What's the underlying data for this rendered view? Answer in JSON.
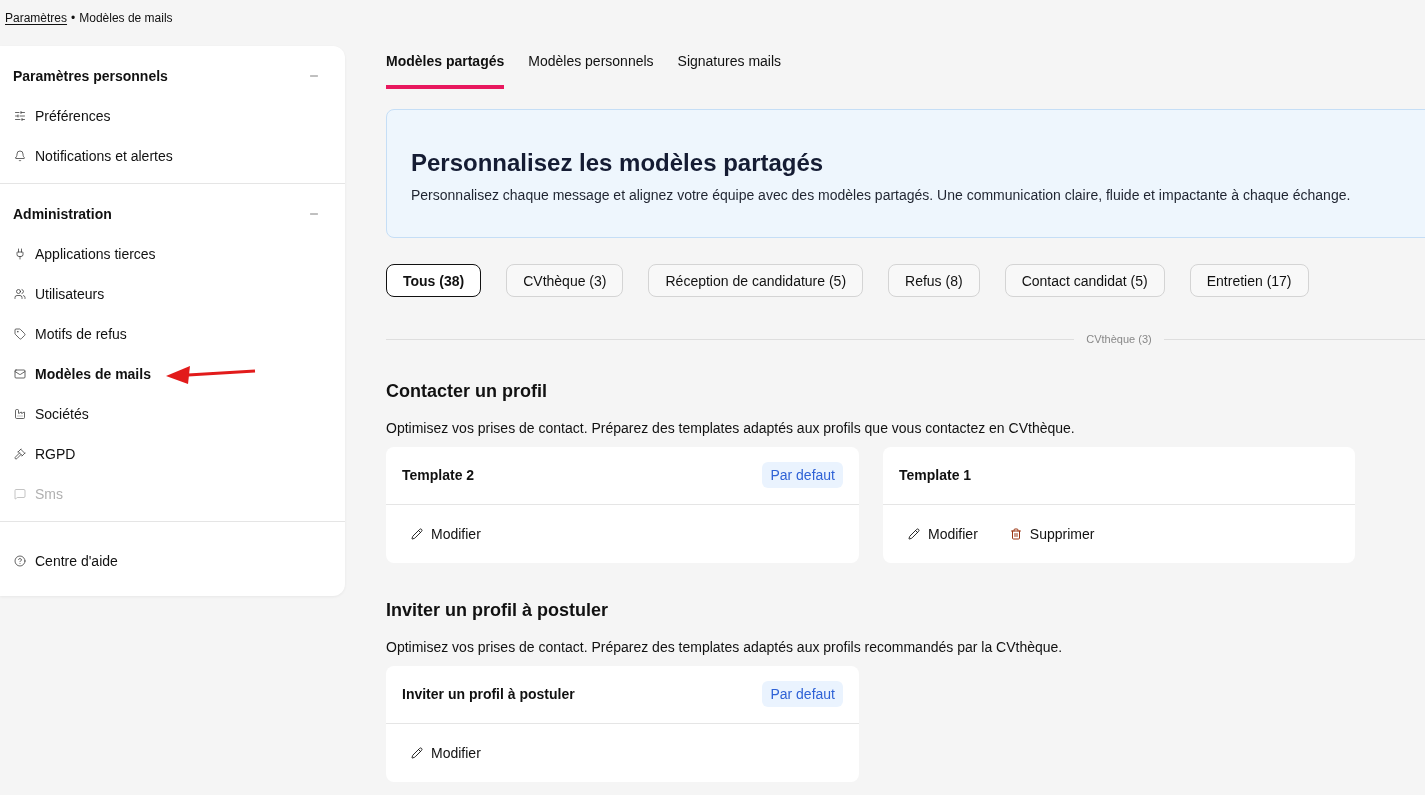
{
  "breadcrumb": {
    "items": [
      {
        "label": "Paramètres",
        "kind": "link"
      },
      {
        "label": "Modèles de mails",
        "kind": "current"
      }
    ],
    "separator": "•"
  },
  "sidebar": {
    "sections": [
      {
        "title": "Paramètres personnels",
        "expanded": true,
        "items": [
          {
            "label": "Préférences",
            "selected": false,
            "disabled": false
          },
          {
            "label": "Notifications et alertes",
            "selected": false,
            "disabled": false
          }
        ]
      },
      {
        "title": "Administration",
        "expanded": true,
        "items": [
          {
            "label": "Applications tierces",
            "selected": false,
            "disabled": false
          },
          {
            "label": "Utilisateurs",
            "selected": false,
            "disabled": false
          },
          {
            "label": "Motifs de refus",
            "selected": false,
            "disabled": false
          },
          {
            "label": "Modèles de mails",
            "selected": true,
            "disabled": false
          },
          {
            "label": "Sociétés",
            "selected": false,
            "disabled": false
          },
          {
            "label": "RGPD",
            "selected": false,
            "disabled": false
          },
          {
            "label": "Sms",
            "selected": false,
            "disabled": true
          }
        ]
      },
      {
        "items": [
          {
            "label": "Centre d'aide",
            "selected": false,
            "disabled": false
          }
        ]
      }
    ]
  },
  "tabs": [
    {
      "label": "Modèles partagés",
      "selected": true
    },
    {
      "label": "Modèles personnels",
      "selected": false
    },
    {
      "label": "Signatures mails",
      "selected": false
    }
  ],
  "banner": {
    "title": "Personnalisez les modèles partagés",
    "text": "Personnalisez chaque message et alignez votre équipe avec des modèles partagés. Une communication claire, fluide et impactante à chaque échange."
  },
  "filters": [
    {
      "label": "Tous (38)",
      "selected": true
    },
    {
      "label": "CVthèque (3)",
      "selected": false
    },
    {
      "label": "Réception de candidature (5)",
      "selected": false
    },
    {
      "label": "Refus (8)",
      "selected": false
    },
    {
      "label": "Contact candidat (5)",
      "selected": false
    },
    {
      "label": "Entretien (17)",
      "selected": false
    }
  ],
  "divider_label": "CVthèque (3)",
  "groups": [
    {
      "title": "Contacter un profil",
      "description": "Optimisez vos prises de contact. Préparez des templates adaptés aux profils que vous contactez en CVthèque.",
      "templates": [
        {
          "name": "Template 2",
          "badge": "Par defaut",
          "actions": [
            {
              "kind": "edit",
              "label": "Modifier"
            }
          ]
        },
        {
          "name": "Template 1",
          "actions": [
            {
              "kind": "edit",
              "label": "Modifier"
            },
            {
              "kind": "delete",
              "label": "Supprimer"
            }
          ]
        }
      ]
    },
    {
      "title": "Inviter un profil à postuler",
      "description": "Optimisez vos prises de contact. Préparez des templates adaptés aux profils recommandés par la CVthèque.",
      "templates": [
        {
          "name": "Inviter un profil à postuler",
          "badge": "Par defaut",
          "actions": [
            {
              "kind": "edit",
              "label": "Modifier"
            }
          ]
        }
      ]
    }
  ]
}
